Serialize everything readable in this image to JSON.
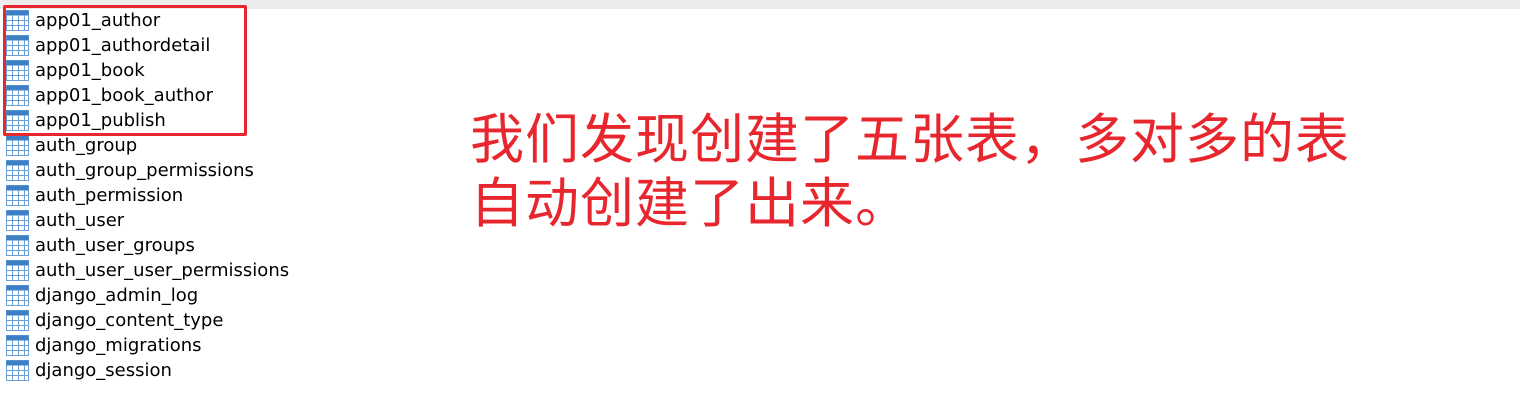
{
  "tables": [
    {
      "name": "app01_author",
      "icon": "table-icon"
    },
    {
      "name": "app01_authordetail",
      "icon": "table-icon"
    },
    {
      "name": "app01_book",
      "icon": "table-icon"
    },
    {
      "name": "app01_book_author",
      "icon": "table-icon"
    },
    {
      "name": "app01_publish",
      "icon": "table-icon"
    },
    {
      "name": "auth_group",
      "icon": "table-icon"
    },
    {
      "name": "auth_group_permissions",
      "icon": "table-icon"
    },
    {
      "name": "auth_permission",
      "icon": "table-icon"
    },
    {
      "name": "auth_user",
      "icon": "table-icon"
    },
    {
      "name": "auth_user_groups",
      "icon": "table-icon"
    },
    {
      "name": "auth_user_user_permissions",
      "icon": "table-icon"
    },
    {
      "name": "django_admin_log",
      "icon": "table-icon"
    },
    {
      "name": "django_content_type",
      "icon": "table-icon"
    },
    {
      "name": "django_migrations",
      "icon": "table-icon"
    },
    {
      "name": "django_session",
      "icon": "table-icon"
    }
  ],
  "annotation": {
    "line1": "我们发现创建了五张表，多对多的表",
    "line2": "自动创建了出来。"
  },
  "colors": {
    "annotation": "#e8262d",
    "highlight_border": "#e8262d",
    "icon_header": "#3d7fc4",
    "icon_grid": "#6b9fd6"
  }
}
